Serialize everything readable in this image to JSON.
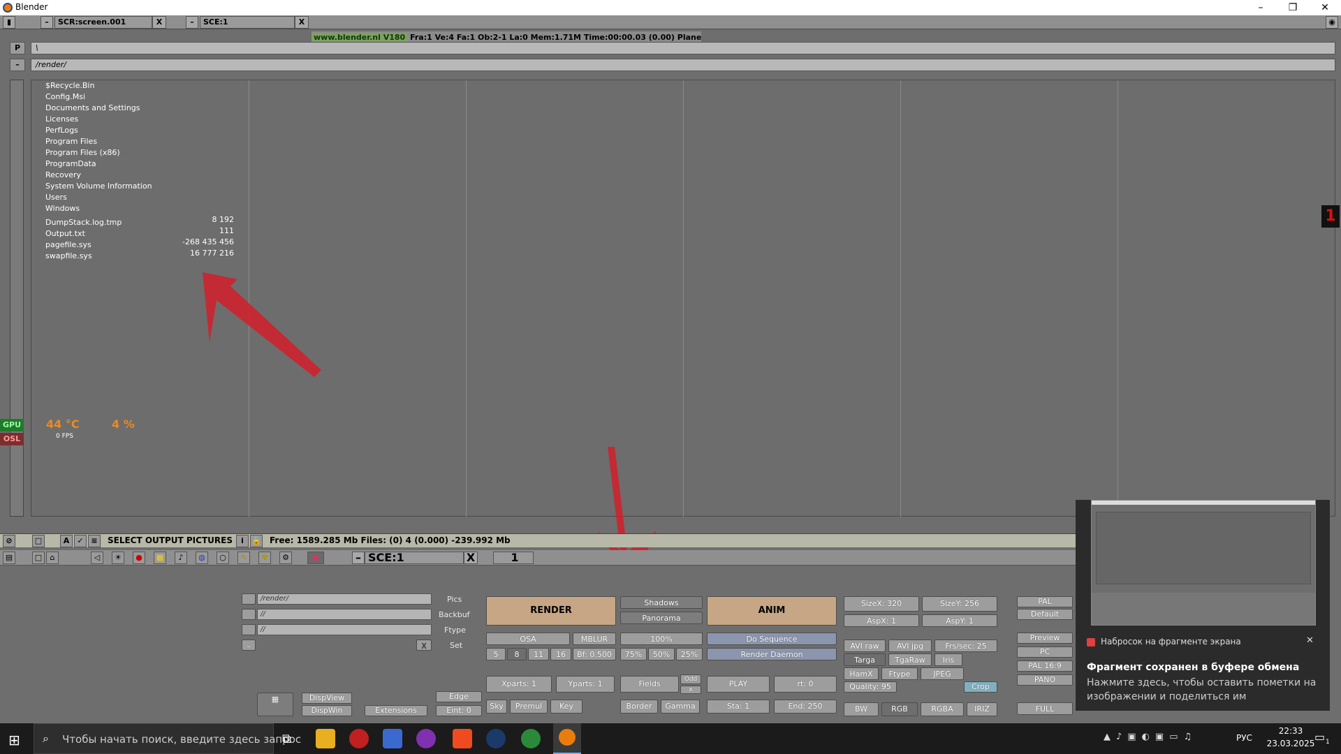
{
  "window": {
    "title": "Blender",
    "minimize": "–",
    "maximize": "❐",
    "close": "✕"
  },
  "topbar": {
    "screen_field": "SCR:screen.001",
    "scene_field": "SCE:1",
    "close_x": "X",
    "info_site": "www.blender.nl V180",
    "info_stats": "Fra:1  Ve:4 Fa:1  Ob:2-1 La:0  Mem:1.71M Time:00:00.03 (0.00)  Plane"
  },
  "filebrowser": {
    "p_label": "P",
    "minus_label": "–",
    "path_top": "\\",
    "path_dir": "/render/",
    "folders": [
      "$Recycle.Bin",
      "Config.Msi",
      "Documents and Settings",
      "Licenses",
      "PerfLogs",
      "Program Files",
      "Program Files (x86)",
      "ProgramData",
      "Recovery",
      "System Volume Information",
      "Users",
      "Windows"
    ],
    "files": [
      {
        "name": "DumpStack.log.tmp",
        "size": "8 192"
      },
      {
        "name": "Output.txt",
        "size": "111"
      },
      {
        "name": "pagefile.sys",
        "size": "-268 435 456"
      },
      {
        "name": "swapfile.sys",
        "size": "16 777 216"
      }
    ],
    "overlay_gpu": "GPU",
    "overlay_osl": "OSL",
    "overlay_temp": "44 °C",
    "overlay_val": "4 %",
    "overlay_fps": "0 FPS",
    "right_marker": "1"
  },
  "filestatus": {
    "title": "SELECT OUTPUT PICTURES",
    "free": "Free: 1589.285 Mb   Files: (0) 4   (0.000) -239.992 Mb"
  },
  "buttonsheader": {
    "scene": "SCE:1",
    "frame": "1"
  },
  "render": {
    "pics_path": "/render/",
    "backbuf_path": "//",
    "ftype_path": "//",
    "pics_lbl": "Pics",
    "backbuf_lbl": "Backbuf",
    "ftype_lbl": "Ftype",
    "set_lbl": "Set",
    "render_btn": "RENDER",
    "shadows": "Shadows",
    "panorama": "Panorama",
    "anim_btn": "ANIM",
    "osa": "OSA",
    "mblur": "MBLUR",
    "percent100": "100%",
    "do_sequence": "Do Sequence",
    "render_daemon": "Render Daemon",
    "osa5": "5",
    "osa8": "8",
    "osa11": "11",
    "osa16": "16",
    "bf": "Bf: 0.500",
    "p75": "75%",
    "p50": "50%",
    "p25": "25%",
    "xparts": "Xparts: 1",
    "yparts": "Yparts: 1",
    "fields": "Fields",
    "odd": "Odd",
    "x": "x",
    "play": "PLAY",
    "rt": "rt: 0",
    "sky": "Sky",
    "premul": "Premul",
    "key": "Key",
    "border": "Border",
    "gamma": "Gamma",
    "sta": "Sta: 1",
    "end": "End: 250",
    "dispview": "DispView",
    "dispwin": "DispWin",
    "extensions": "Extensions",
    "edge": "Edge",
    "eint": "Eint: 0",
    "sizex": "SizeX: 320",
    "sizey": "SizeY: 256",
    "aspx": "AspX: 1",
    "aspy": "AspY: 1",
    "avi_raw": "AVI raw",
    "avi_jpg": "AVI jpg",
    "frs_sec": "Frs/sec: 25",
    "targa": "Targa",
    "tga_raw": "TgaRaw",
    "iris": "Iris",
    "hamx": "HamX",
    "ftype_btn": "Ftype",
    "jpeg": "JPEG",
    "quality": "Quality: 95",
    "crop": "Crop",
    "bw": "BW",
    "rgb": "RGB",
    "rgba": "RGBA",
    "iriz": "IRIZ",
    "pal": "PAL",
    "default": "Default",
    "preview": "Preview",
    "pc": "PC",
    "pal169": "PAL 16:9",
    "pano": "PANO",
    "full": "FULL"
  },
  "notification": {
    "app": "Набросок на фрагменте экрана",
    "close": "✕",
    "title": "Фрагмент сохранен в буфере обмена",
    "body": "Нажмите здесь, чтобы оставить пометки на изображении и поделиться им"
  },
  "taskbar": {
    "search_placeholder": "Чтобы начать поиск, введите здесь запрос",
    "lang": "РУС",
    "time": "22:33",
    "date": "23.03.2025",
    "notif_count": "1"
  }
}
